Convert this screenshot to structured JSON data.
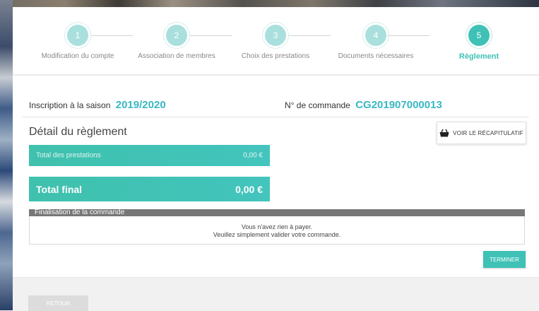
{
  "steps": [
    {
      "number": "1",
      "label": "Modification du compte"
    },
    {
      "number": "2",
      "label": "Association de membres"
    },
    {
      "number": "3",
      "label": "Choix des prestations"
    },
    {
      "number": "4",
      "label": "Documents nécessaires"
    },
    {
      "number": "5",
      "label": "Règlement"
    }
  ],
  "info": {
    "season_label": "Inscription à la saison",
    "season_value": "2019/2020",
    "order_label": "N° de commande",
    "order_value": "CG201907000013"
  },
  "detail": {
    "title": "Détail du règlement",
    "recap_button": "VOIR LE RÉCAPITULATIF",
    "total_prestations_label": "Total des prestations",
    "total_prestations_value": "0,00 €",
    "total_final_label": "Total final",
    "total_final_value": "0,00 €"
  },
  "finalisation": {
    "header": "Finalisation de la commande",
    "line1": "Vous n'avez rien à payer.",
    "line2": "Veuillez simplement valider votre commande."
  },
  "buttons": {
    "terminer": "TERMINER",
    "retour": "RETOUR"
  },
  "colors": {
    "accent": "#3fc1b6",
    "step_inactive": "#a9e0dd",
    "order_text": "#3ab7c2"
  },
  "icons": {
    "recap": "basket-icon"
  }
}
